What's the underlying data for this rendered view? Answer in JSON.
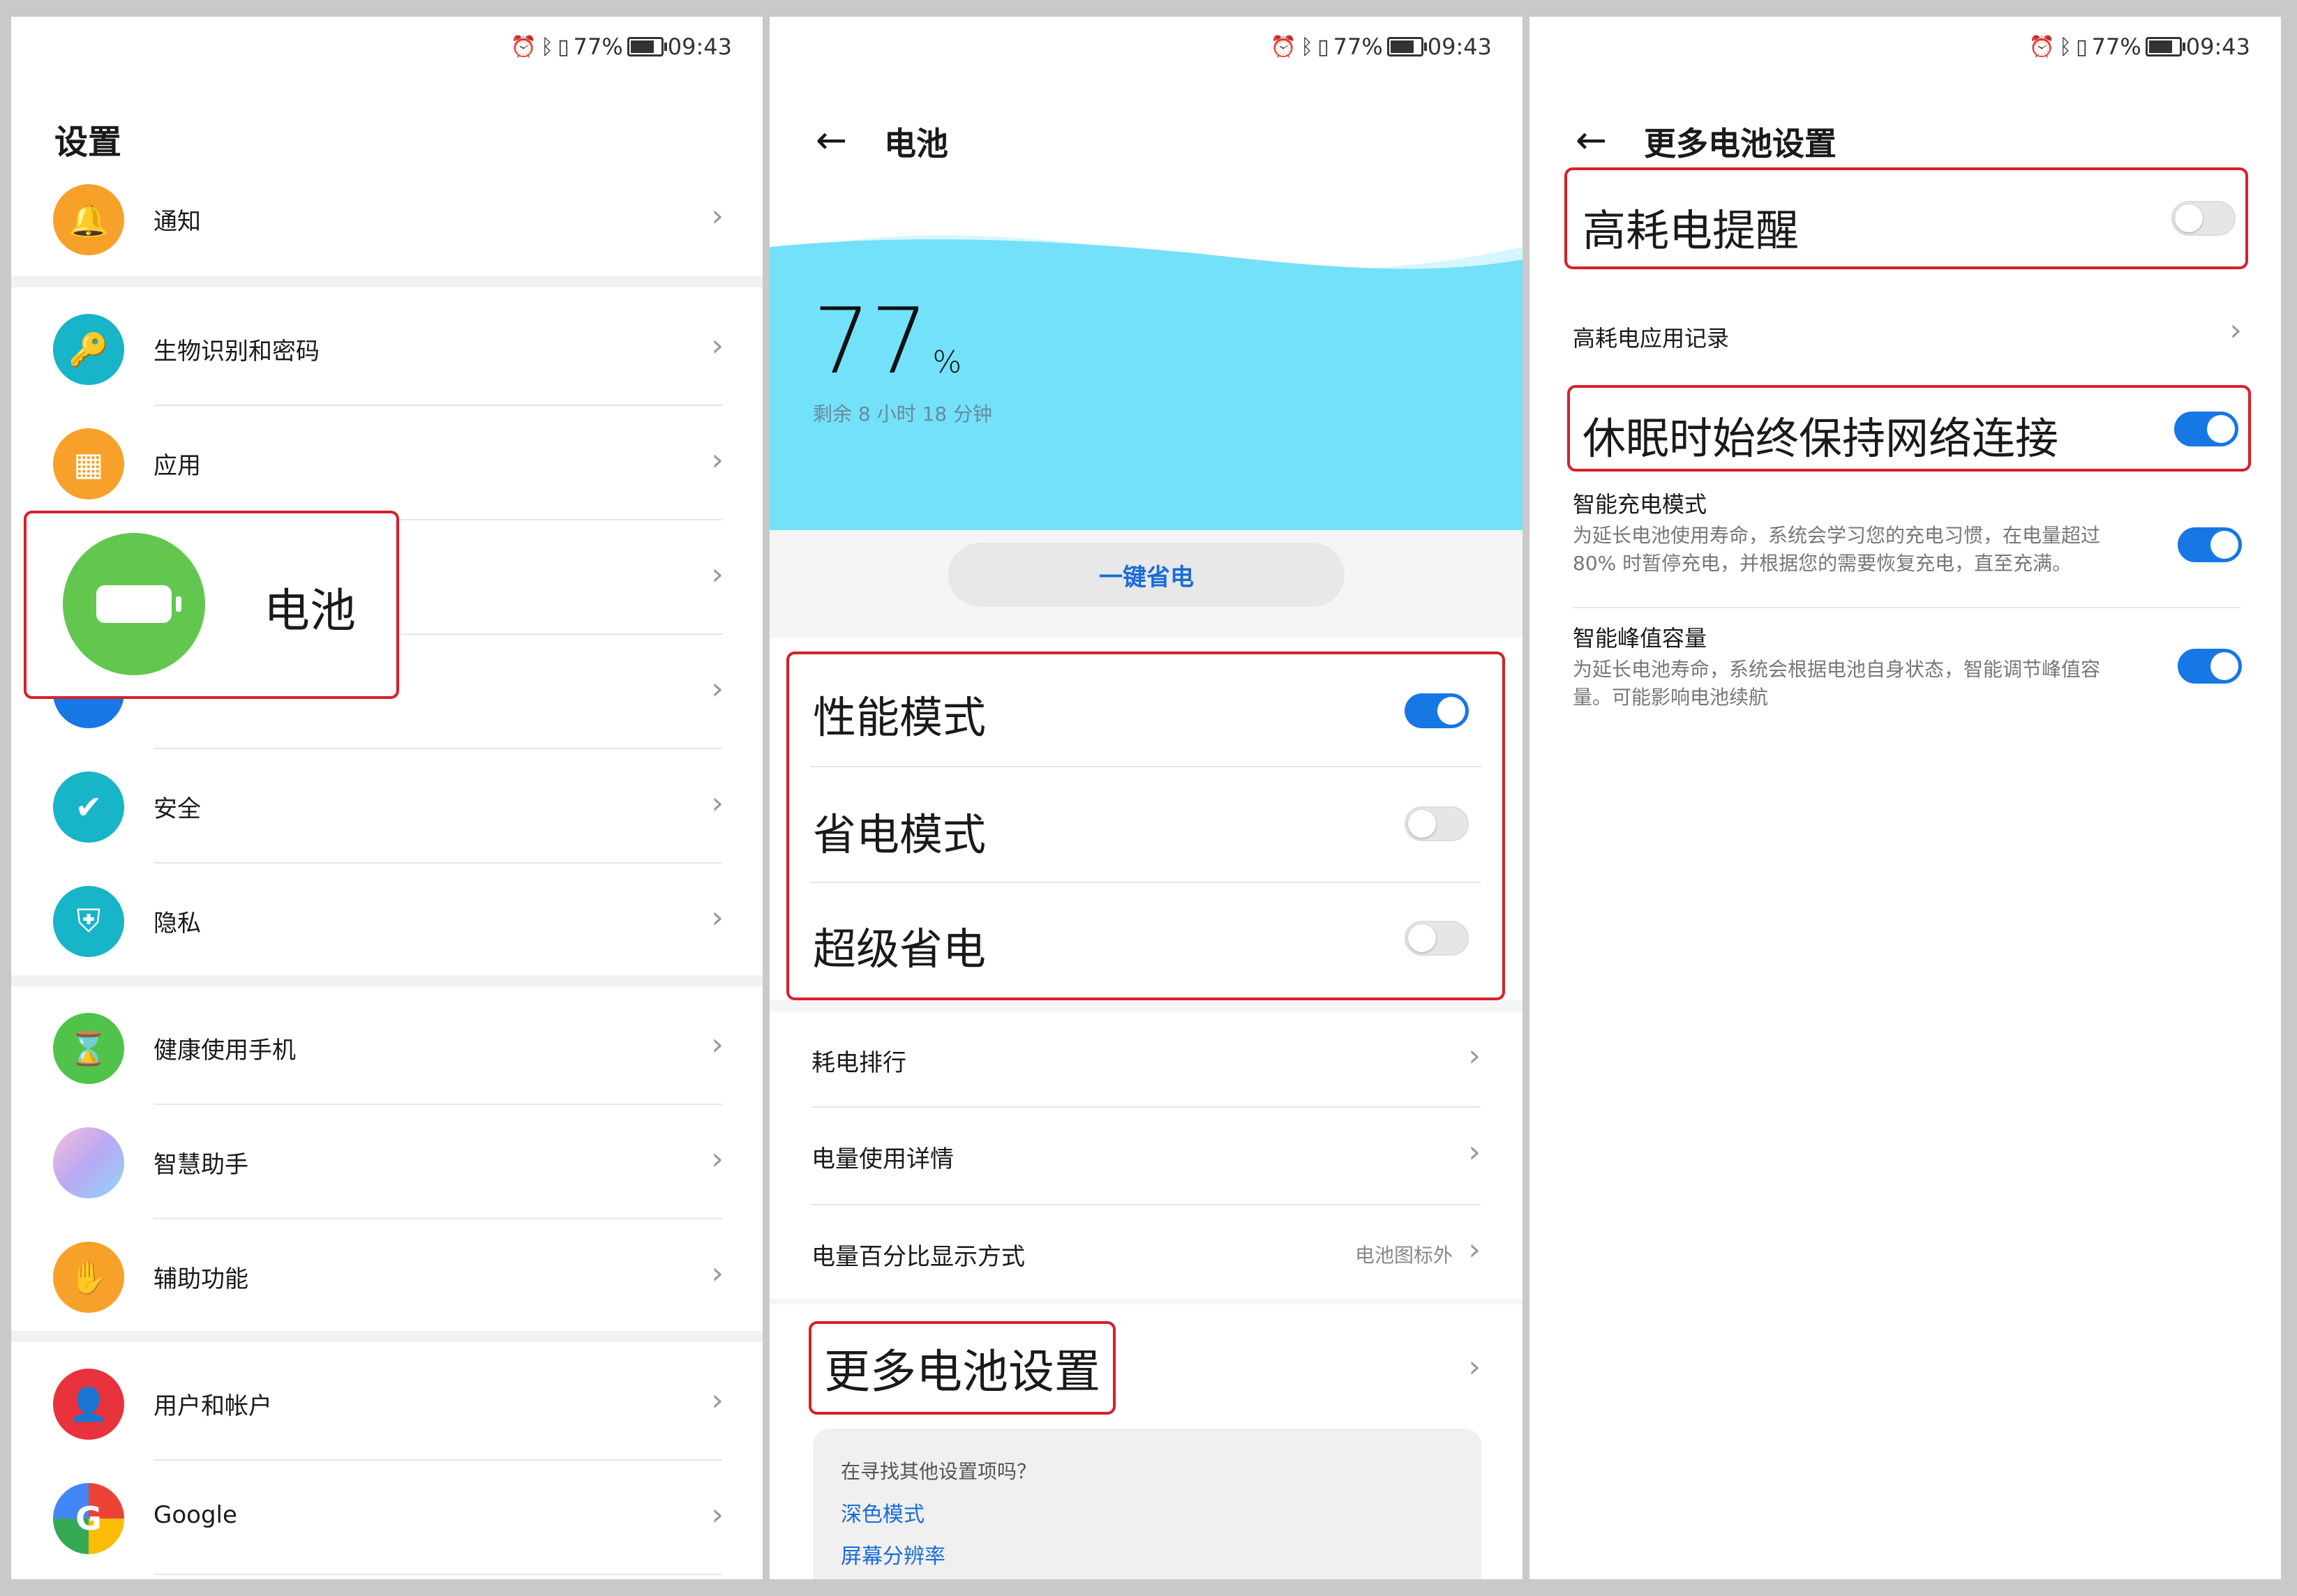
{
  "status": {
    "percent": "77%",
    "time": "09:43"
  },
  "settings": {
    "title": "设置",
    "items": [
      {
        "label": "通知",
        "icon": "bell-icon",
        "color": "#f7a12a"
      },
      {
        "label": "生物识别和密码",
        "icon": "key-icon",
        "color": "#18b4c8"
      },
      {
        "label": "应用",
        "icon": "apps-icon",
        "color": "#f7a12a"
      },
      {
        "label": "安全",
        "icon": "shield-check-icon",
        "color": "#18b4c8"
      },
      {
        "label": "隐私",
        "icon": "privacy-shield-icon",
        "color": "#18b4c8"
      },
      {
        "label": "健康使用手机",
        "icon": "hourglass-icon",
        "color": "#4fc34a"
      },
      {
        "label": "智慧助手",
        "icon": "assistant-icon",
        "color": "#c8a0f0"
      },
      {
        "label": "辅助功能",
        "icon": "hand-icon",
        "color": "#f7a12a"
      },
      {
        "label": "用户和帐户",
        "icon": "user-icon",
        "color": "#e8323c"
      },
      {
        "label": "Google",
        "icon": "google-icon",
        "color": "#4285f4"
      }
    ],
    "battery_callout": {
      "label": "电池",
      "color": "#63c74f"
    }
  },
  "battery": {
    "title": "电池",
    "percent": "77",
    "percent_unit": "%",
    "remaining": "剩余 8 小时 18 分钟",
    "save_button": "一键省电",
    "modes": [
      {
        "label": "性能模式",
        "on": true
      },
      {
        "label": "省电模式",
        "on": false
      },
      {
        "label": "超级省电",
        "on": false
      }
    ],
    "items": [
      {
        "label": "耗电排行"
      },
      {
        "label": "电量使用详情"
      },
      {
        "label": "电量百分比显示方式",
        "value": "电池图标外"
      }
    ],
    "more_settings": "更多电池设置",
    "search": {
      "question": "在寻找其他设置项吗？",
      "links": [
        "深色模式",
        "屏幕分辨率"
      ]
    },
    "wave_color": "#74e1fa"
  },
  "more": {
    "title": "更多电池设置",
    "high_drain_alert": {
      "label": "高耗电提醒",
      "on": false
    },
    "high_drain_record": "高耗电应用记录",
    "keep_network": {
      "label": "休眠时始终保持网络连接",
      "on": true
    },
    "smart_charge": {
      "label": "智能充电模式",
      "desc": "为延长电池使用寿命，系统会学习您的充电习惯，在电量超过80% 时暂停充电，并根据您的需要恢复充电，直至充满。",
      "on": true
    },
    "peak_capacity": {
      "label": "智能峰值容量",
      "desc": "为延长电池寿命，系统会根据电池自身状态，智能调节峰值容量。可能影响电池续航",
      "on": true
    }
  },
  "accent": "#1677e5",
  "highlight": "#d6202a"
}
